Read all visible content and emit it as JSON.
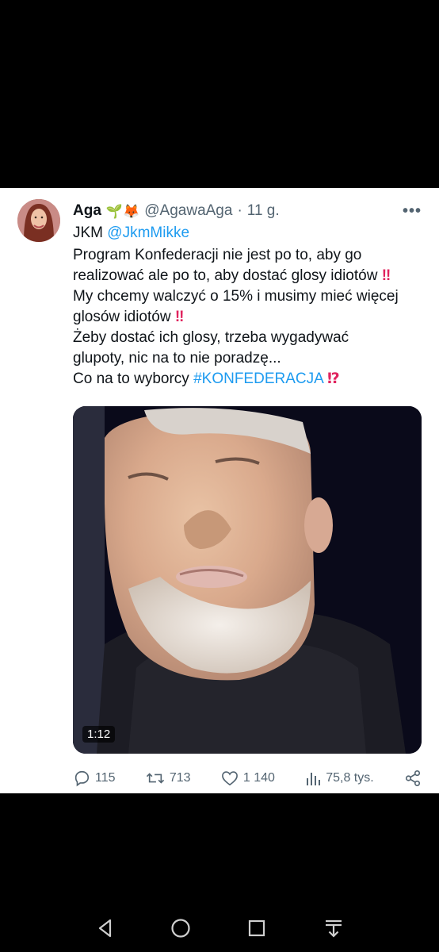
{
  "tweet": {
    "author_name": "Aga",
    "author_emojis": "🌱🦊",
    "handle": "@AgawaAga",
    "separator": "·",
    "time": "11 g.",
    "more_label": "•••",
    "reply_prefix": "JKM",
    "reply_mention": "@JkmMikke",
    "lines": {
      "l1": "Program Konfederacji nie jest po to, aby go",
      "l2": "realizować ale po to, aby dostać glosy idiotów",
      "l2_mark": "‼",
      "l3": "My chcemy walczyć o 15% i musimy mieć więcej",
      "l4": "glosów idiotów",
      "l4_mark": "‼",
      "l5": "Żeby dostać ich glosy, trzeba wygadywać",
      "l6": "glupoty, nic na to nie poradzę...",
      "l7_prefix": "Co na to wyborcy",
      "l7_hashtag": "#KONFEDERACJA",
      "l7_mark": "⁉"
    },
    "video": {
      "duration": "1:12"
    },
    "stats": {
      "replies": "115",
      "retweets": "713",
      "likes": "1 140",
      "views": "75,8 tys."
    }
  },
  "colors": {
    "link": "#1d9bf0",
    "emoji_red": "#e0245e",
    "muted": "#536471"
  },
  "navbar": {
    "icons": [
      "back-icon",
      "home-icon",
      "recents-icon",
      "notification-pull-icon"
    ]
  }
}
